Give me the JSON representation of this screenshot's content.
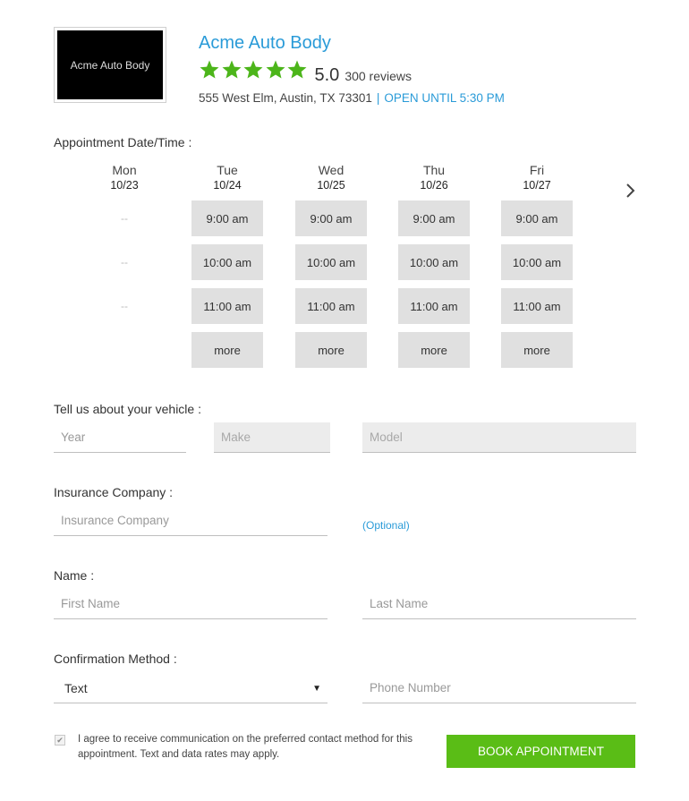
{
  "business": {
    "logo_text": "Acme Auto Body",
    "name": "Acme Auto Body",
    "rating": 5,
    "rating_max": 5,
    "score": "5.0",
    "reviews": "300 reviews",
    "address": "555 West Elm, Austin, TX 73301",
    "separator": "|",
    "open_status": "OPEN UNTIL 5:30 PM",
    "star_color": "#4cb51a",
    "accent_color": "#2a9bd8"
  },
  "appointment": {
    "label": "Appointment Date/Time :",
    "days": [
      {
        "name": "Mon",
        "date": "10/23",
        "slots": [
          "--",
          "--",
          "--"
        ],
        "more": ""
      },
      {
        "name": "Tue",
        "date": "10/24",
        "slots": [
          "9:00 am",
          "10:00 am",
          "11:00 am"
        ],
        "more": "more"
      },
      {
        "name": "Wed",
        "date": "10/25",
        "slots": [
          "9:00 am",
          "10:00 am",
          "11:00 am"
        ],
        "more": "more"
      },
      {
        "name": "Thu",
        "date": "10/26",
        "slots": [
          "9:00 am",
          "10:00 am",
          "11:00 am"
        ],
        "more": "more"
      },
      {
        "name": "Fri",
        "date": "10/27",
        "slots": [
          "9:00 am",
          "10:00 am",
          "11:00 am"
        ],
        "more": "more"
      }
    ],
    "next_icon": "chevron-right-icon"
  },
  "vehicle": {
    "label": "Tell us about your vehicle :",
    "year_placeholder": "Year",
    "make_placeholder": "Make",
    "model_placeholder": "Model"
  },
  "insurance": {
    "label": "Insurance Company :",
    "placeholder": "Insurance Company",
    "optional": "(Optional)"
  },
  "name": {
    "label": "Name :",
    "first_placeholder": "First Name",
    "last_placeholder": "Last Name"
  },
  "confirmation": {
    "label": "Confirmation Method :",
    "selected": "Text",
    "arrow": "▼",
    "phone_placeholder": "Phone Number"
  },
  "consent": {
    "checked": true,
    "check_mark": "✔",
    "text": "I agree to receive communication on the preferred contact method for this appointment. Text and data rates may apply."
  },
  "book_button": "BOOK APPOINTMENT",
  "button_color": "#5abd16"
}
